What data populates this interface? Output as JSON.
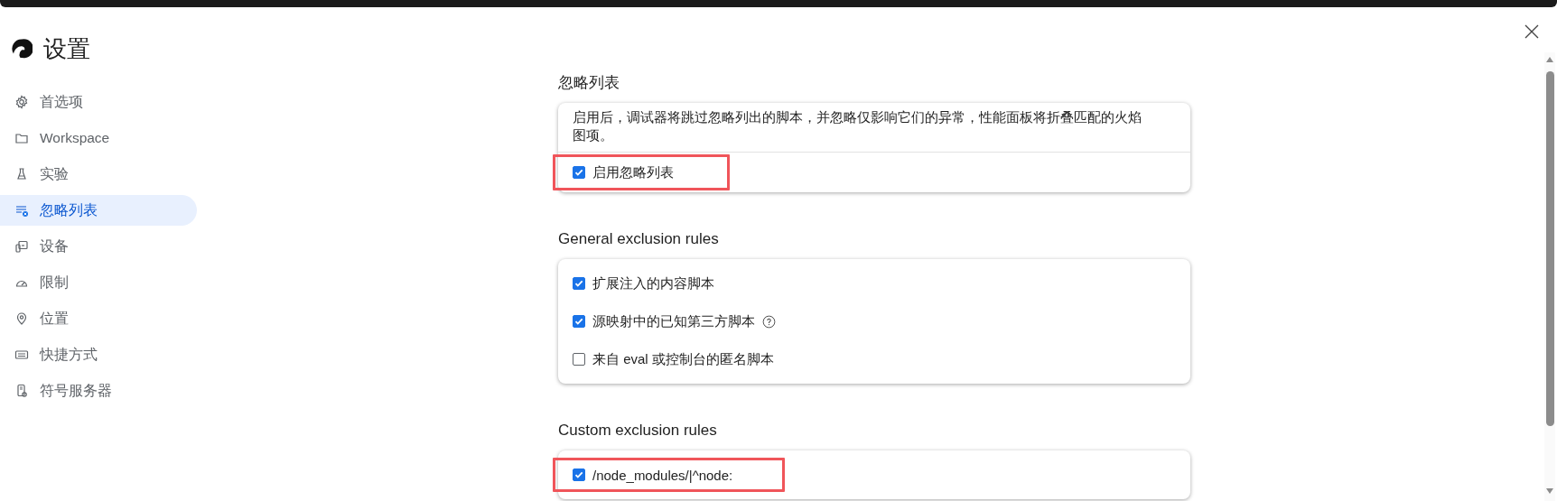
{
  "window": {
    "title": "设置"
  },
  "sidebar": {
    "items": [
      {
        "label": "首选项",
        "selected": false
      },
      {
        "label": "Workspace",
        "selected": false
      },
      {
        "label": "实验",
        "selected": false
      },
      {
        "label": "忽略列表",
        "selected": true
      },
      {
        "label": "设备",
        "selected": false
      },
      {
        "label": "限制",
        "selected": false
      },
      {
        "label": "位置",
        "selected": false
      },
      {
        "label": "快捷方式",
        "selected": false
      },
      {
        "label": "符号服务器",
        "selected": false
      }
    ]
  },
  "sections": [
    {
      "heading": "忽略列表",
      "description": "启用后，调试器将跳过忽略列出的脚本，并忽略仅影响它们的异常，性能面板将折叠匹配的火焰图项。",
      "options": [
        {
          "label": "启用忽略列表",
          "checked": true,
          "help": false,
          "highlighted": true
        }
      ]
    },
    {
      "heading": "General exclusion rules",
      "options": [
        {
          "label": "扩展注入的内容脚本",
          "checked": true,
          "help": false,
          "highlighted": false
        },
        {
          "label": "源映射中的已知第三方脚本",
          "checked": true,
          "help": true,
          "highlighted": false
        },
        {
          "label": "来自 eval 或控制台的匿名脚本",
          "checked": false,
          "help": false,
          "highlighted": false
        }
      ]
    },
    {
      "heading": "Custom exclusion rules",
      "options": [
        {
          "label": "/node_modules/|^node:",
          "checked": true,
          "help": false,
          "highlighted": true
        }
      ]
    }
  ]
}
